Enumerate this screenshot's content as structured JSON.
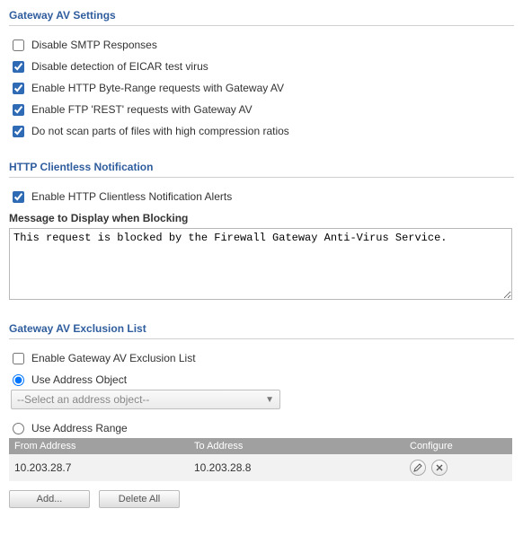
{
  "sections": {
    "av_settings_title": "Gateway AV Settings",
    "clientless_title": "HTTP Clientless Notification",
    "exclusion_title": "Gateway AV Exclusion List"
  },
  "av_settings": {
    "disable_smtp": {
      "label": "Disable SMTP Responses",
      "checked": false
    },
    "disable_eicar": {
      "label": "Disable detection of EICAR test virus",
      "checked": true
    },
    "enable_http_byterange": {
      "label": "Enable HTTP Byte-Range requests with Gateway AV",
      "checked": true
    },
    "enable_ftp_rest": {
      "label": "Enable FTP 'REST' requests with Gateway AV",
      "checked": true
    },
    "skip_high_compression": {
      "label": "Do not scan parts of files with high compression ratios",
      "checked": true
    }
  },
  "clientless": {
    "enable_alerts": {
      "label": "Enable HTTP Clientless Notification Alerts",
      "checked": true
    },
    "message_label": "Message to Display when Blocking",
    "message_value": "This request is blocked by the Firewall Gateway Anti-Virus Service."
  },
  "exclusion": {
    "enable": {
      "label": "Enable Gateway AV Exclusion List",
      "checked": false
    },
    "use_object": {
      "label": "Use Address Object",
      "selected": true
    },
    "object_placeholder": "--Select an address object--",
    "use_range": {
      "label": "Use Address Range",
      "selected": false
    },
    "table": {
      "headers": {
        "from": "From Address",
        "to": "To Address",
        "configure": "Configure"
      },
      "rows": [
        {
          "from": "10.203.28.7",
          "to": "10.203.28.8"
        }
      ]
    },
    "buttons": {
      "add": "Add...",
      "delete_all": "Delete All"
    }
  }
}
